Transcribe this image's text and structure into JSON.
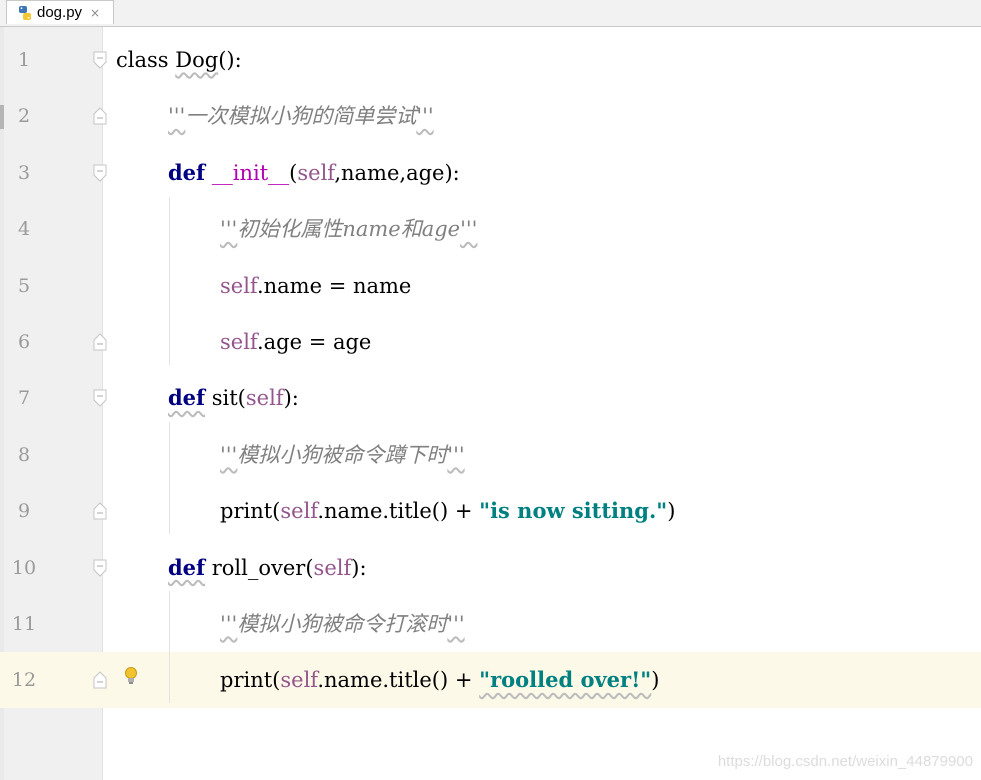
{
  "tab": {
    "filename": "dog.py",
    "close": "×",
    "icon": "python-file-icon"
  },
  "lines": [
    {
      "number": "1",
      "parts": [
        {
          "text": "class",
          "style": "plain"
        },
        {
          "text": " ",
          "style": "plain"
        },
        {
          "text": "Dog",
          "style": "plain"
        },
        {
          "text": "():",
          "style": "plain"
        }
      ]
    },
    {
      "number": "2",
      "parts": [
        {
          "text": "'''",
          "style": "doc"
        },
        {
          "text": "一次模拟小狗的简单尝试",
          "style": "doc"
        },
        {
          "text": "'''",
          "style": "doc"
        }
      ]
    },
    {
      "number": "3",
      "parts": [
        {
          "text": "def",
          "style": "kw"
        },
        {
          "text": " ",
          "style": "plain"
        },
        {
          "text": "__init__",
          "style": "dunder"
        },
        {
          "text": "(",
          "style": "plain"
        },
        {
          "text": "self",
          "style": "self"
        },
        {
          "text": ",name,age):",
          "style": "plain"
        }
      ]
    },
    {
      "number": "4",
      "parts": [
        {
          "text": "'''",
          "style": "doc"
        },
        {
          "text": "初始化属性name和age",
          "style": "doc"
        },
        {
          "text": "'''",
          "style": "doc"
        }
      ]
    },
    {
      "number": "5",
      "parts": [
        {
          "text": "self",
          "style": "self"
        },
        {
          "text": ".name = name",
          "style": "plain"
        }
      ]
    },
    {
      "number": "6",
      "parts": [
        {
          "text": "self",
          "style": "self"
        },
        {
          "text": ".age = age",
          "style": "plain"
        }
      ]
    },
    {
      "number": "7",
      "parts": [
        {
          "text": "def",
          "style": "kw"
        },
        {
          "text": " sit(",
          "style": "plain"
        },
        {
          "text": "self",
          "style": "self"
        },
        {
          "text": "):",
          "style": "plain"
        }
      ]
    },
    {
      "number": "8",
      "parts": [
        {
          "text": "'''",
          "style": "doc"
        },
        {
          "text": "模拟小狗被命令蹲下时",
          "style": "doc"
        },
        {
          "text": "'''",
          "style": "doc"
        }
      ]
    },
    {
      "number": "9",
      "parts": [
        {
          "text": "print(",
          "style": "plain"
        },
        {
          "text": "self",
          "style": "self"
        },
        {
          "text": ".name.title() + ",
          "style": "plain"
        },
        {
          "text": "\"is now sitting.\"",
          "style": "str"
        },
        {
          "text": ")",
          "style": "plain"
        }
      ]
    },
    {
      "number": "10",
      "parts": [
        {
          "text": "def",
          "style": "kw"
        },
        {
          "text": " roll_over(",
          "style": "plain"
        },
        {
          "text": "self",
          "style": "self"
        },
        {
          "text": "):",
          "style": "plain"
        }
      ]
    },
    {
      "number": "11",
      "parts": [
        {
          "text": "'''",
          "style": "doc"
        },
        {
          "text": "模拟小狗被命令打滚时",
          "style": "doc"
        },
        {
          "text": "'''",
          "style": "doc"
        }
      ]
    },
    {
      "number": "12",
      "parts": [
        {
          "text": "print(",
          "style": "plain"
        },
        {
          "text": "self",
          "style": "self"
        },
        {
          "text": ".name.title() + ",
          "style": "plain"
        },
        {
          "text": "\"roolled over!\"",
          "style": "str"
        },
        {
          "text": ")",
          "style": "plain"
        }
      ]
    }
  ],
  "colors": {
    "keyword": "#000080",
    "self": "#94558d",
    "string": "#008080",
    "docstring": "#808080",
    "dunder": "#b200b2",
    "current_line": "#fcf9e8"
  },
  "watermark": "https://blog.csdn.net/weixin_44879900"
}
